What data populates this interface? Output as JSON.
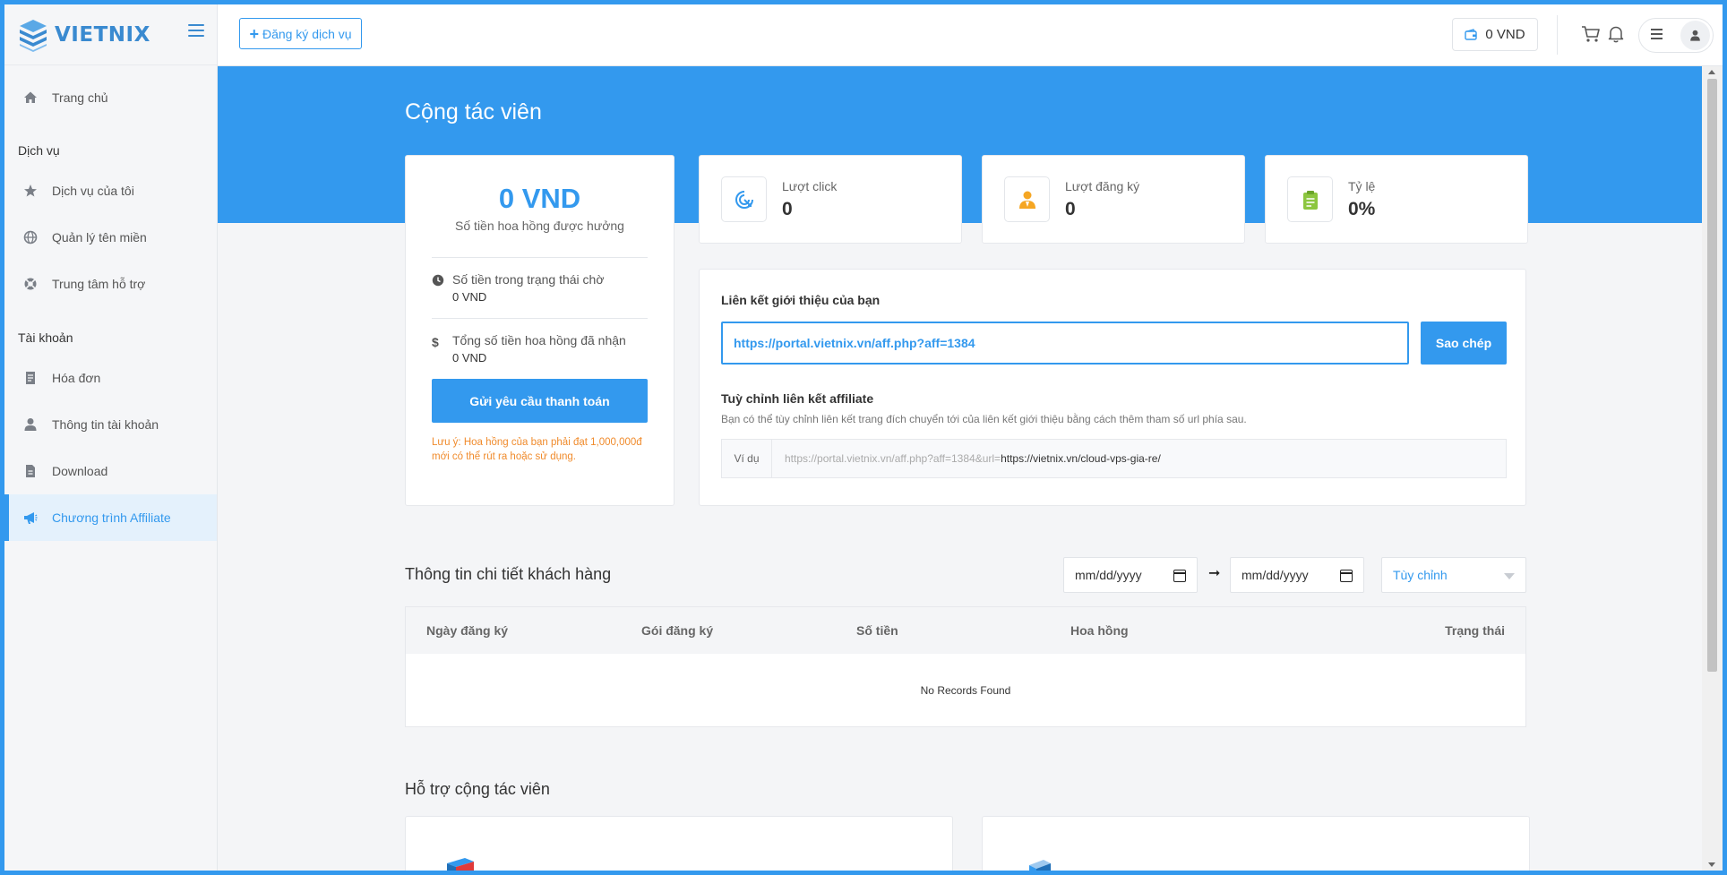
{
  "brand": {
    "name": "VIETNIX"
  },
  "sidebar": {
    "home": "Trang chủ",
    "section_services": "Dịch vụ",
    "my_services": "Dịch vụ của tôi",
    "domains": "Quản lý tên miền",
    "support": "Trung tâm hỗ trợ",
    "section_account": "Tài khoản",
    "invoices": "Hóa đơn",
    "account_info": "Thông tin tài khoản",
    "download": "Download",
    "affiliate": "Chương trình Affiliate"
  },
  "topbar": {
    "register_label": "Đăng ký dịch vụ",
    "wallet": "0 VND"
  },
  "page": {
    "title": "Cộng tác viên"
  },
  "commission": {
    "amount": "0 VND",
    "amount_label": "Số tiền hoa hồng được hưởng",
    "pending_label": "Số tiền trong trạng thái chờ",
    "pending_value": "0 VND",
    "received_label": "Tổng số tiền hoa hồng đã nhận",
    "received_value": "0 VND",
    "pay_button": "Gửi yêu cầu thanh toán",
    "note": "Lưu ý: Hoa hồng của bạn phải đạt 1,000,000đ mới có thể rút ra hoặc sử dụng."
  },
  "stats": [
    {
      "label": "Lượt click",
      "value": "0",
      "icon": "click-target-icon"
    },
    {
      "label": "Lượt đăng ký",
      "value": "0",
      "icon": "user-signup-icon"
    },
    {
      "label": "Tỷ lệ",
      "value": "0%",
      "icon": "clipboard-icon"
    }
  ],
  "referral": {
    "title": "Liên kết giới thiệu của bạn",
    "url": "https://portal.vietnix.vn/aff.php?aff=1384",
    "copy_button": "Sao chép",
    "custom_title": "Tuỳ chỉnh liên kết affiliate",
    "custom_desc": "Bạn có thể tùy chỉnh liên kết trang đích chuyển tới của liên kết giới thiệu bằng cách thêm tham số url phía sau.",
    "example_label": "Ví dụ",
    "example_base": "https://portal.vietnix.vn/aff.php?aff=1384&url=",
    "example_tail": "https://vietnix.vn/cloud-vps-gia-re/"
  },
  "customers": {
    "title": "Thông tin chi tiết khách hàng",
    "date_from": "mm/dd/yyyy",
    "date_to": "mm/dd/yyyy",
    "filter": "Tùy chỉnh",
    "columns": [
      "Ngày đăng ký",
      "Gói đăng ký",
      "Số tiền",
      "Hoa hồng",
      "Trạng thái"
    ],
    "empty": "No Records Found"
  },
  "support": {
    "title": "Hỗ trợ cộng tác viên"
  },
  "colors": {
    "accent": "#3399ee",
    "warning": "#f08b2c"
  }
}
